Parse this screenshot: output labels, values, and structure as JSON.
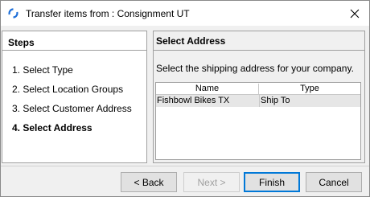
{
  "window": {
    "title": "Transfer items from : Consignment UT",
    "app_icon": "refresh-arrows-icon",
    "close_icon": "close-icon"
  },
  "steps": {
    "title": "Steps",
    "items": [
      {
        "label": "1.  Select Type",
        "active": false
      },
      {
        "label": "2.  Select Location Groups",
        "active": false
      },
      {
        "label": "3.  Select Customer Address",
        "active": false
      },
      {
        "label": "4.  Select Address",
        "active": true
      }
    ]
  },
  "main": {
    "title": "Select Address",
    "instruction": "Select the shipping address for your company.",
    "table": {
      "columns": [
        "Name",
        "Type"
      ],
      "rows": [
        {
          "name": "Fishbowl Bikes TX",
          "type": "Ship To"
        }
      ]
    }
  },
  "buttons": {
    "back": "< Back",
    "next": "Next >",
    "finish": "Finish",
    "cancel": "Cancel"
  },
  "colors": {
    "accent": "#0078d7",
    "selected_row": "#e6e6e6"
  }
}
